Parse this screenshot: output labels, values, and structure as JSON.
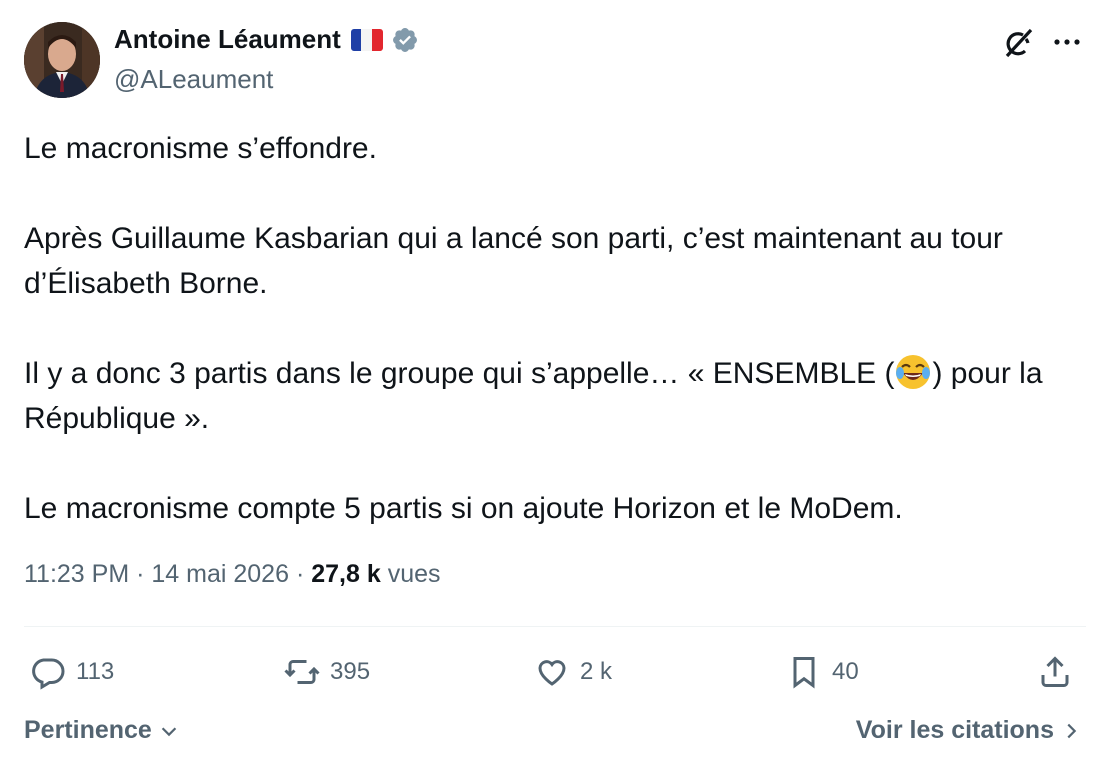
{
  "author": {
    "name": "Antoine Léaument",
    "handle": "@ALeaument"
  },
  "tweet": {
    "paragraphs": [
      "Le macronisme s’effondre.",
      "Après Guillaume Kasbarian qui a lancé son parti, c’est maintenant au tour d’Élisabeth Borne.",
      "Le macronisme compte 5 partis si on ajoute Horizon et le MoDem."
    ],
    "p3_before": "Il y a donc 3 partis dans le groupe qui s’appelle… « ENSEMBLE (",
    "p3_after": ") pour la République »."
  },
  "meta": {
    "time": "11:23 PM",
    "separator": "·",
    "date": "14 mai 2026",
    "views": "27,8 k",
    "views_label": "vues"
  },
  "actions": {
    "replies": "113",
    "reposts": "395",
    "likes": "2 k",
    "bookmarks": "40"
  },
  "footer": {
    "sort_label": "Pertinence",
    "quotes_label": "Voir les citations"
  },
  "colors": {
    "text": "#0f1419",
    "secondary": "#536471",
    "verified": "#829aab",
    "divider": "#eff3f4"
  },
  "icons": [
    "verified-badge-icon",
    "grok-icon",
    "more-icon",
    "reply-icon",
    "repost-icon",
    "like-icon",
    "bookmark-icon",
    "share-icon",
    "chevron-down-icon",
    "chevron-right-icon",
    "laughing-emoji-icon"
  ]
}
